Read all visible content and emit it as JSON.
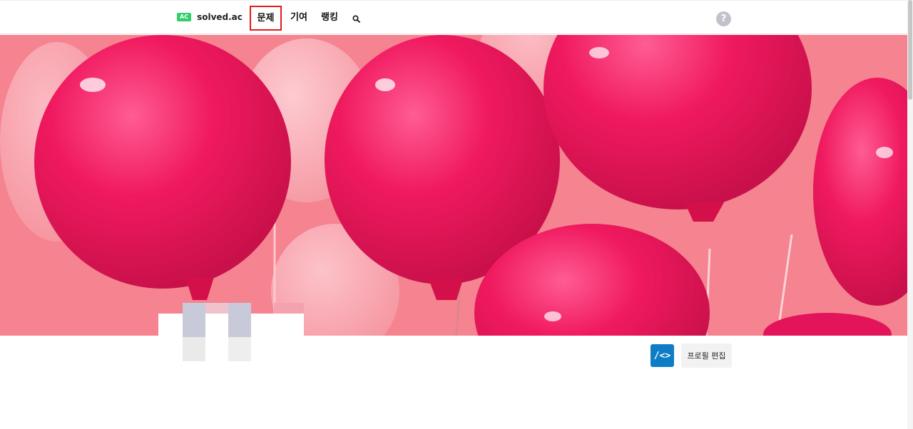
{
  "header": {
    "logo_badge": "AC",
    "logo_text": "solved.ac",
    "nav": {
      "problems": "문제",
      "contribute": "기여",
      "ranking": "랭킹"
    },
    "search_icon": "search-icon",
    "help_icon": "help-icon",
    "help_glyph": "?"
  },
  "profile": {
    "tool_button_label": "/<>",
    "tool_icon": "code-icon",
    "edit_button_label": "프로필 편집"
  },
  "colors": {
    "logo_badge": "#2fd067",
    "highlight_box": "#e21b1b",
    "tool_button": "#0f7dc6",
    "banner_background": "#f47a8a",
    "balloon": "#f0195f"
  }
}
